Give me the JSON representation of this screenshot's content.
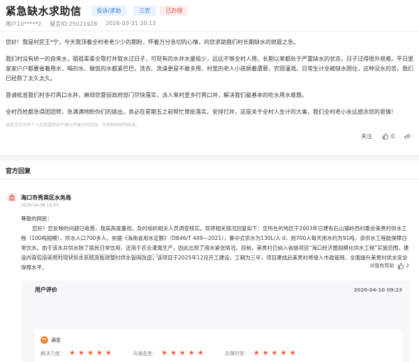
{
  "header": {
    "title": "紧急缺水求助信",
    "tags": [
      "投诉/求助",
      "三农",
      "已办理"
    ]
  },
  "meta": {
    "user": "用户10*****2",
    "message_id": "留言ID:25021928",
    "datetime": "2026-03-31 20:13"
  },
  "letter": {
    "paragraphs": [
      "您好！我是村民王*宁，今天我顶着全村老老少少的期盼，怀着万分急切的心情，向您求助我们村长期缺水的燃眉之急。",
      "我们村没有统一的自来水，祖祖辈辈全靠打井取水过日子，可现有的水井水量极少，远远不够全村人用，长期以来都处于严重缺水的状态，日子过得很外艰难。平日里家家户户都要省着用水，喝的水、做饭的水都紧巴巴，洗衣、洗澡更是不敢多用，村里的老人小孩顾着遭罪，农田灌溉、日常生计全被缺水困住，这种没水的苦，我们已经熬了太久太久。",
      "恳请批准我们村多打两口水井，麻烦您督促政府部门尽快落实，派人来村里多打两口井，解决我们最基本的吃水用水难题。",
      "全村百姓都急得团团转，急满满地盼你们的挑出，务必在星期五之前帮忙审批落实、安排打井，这是关于全村人生计的大事，我们全村老小永远感念您的恩情！"
    ],
    "note": "该留言中涉有个人信息或网站不便公开展示的内容，仅供相关机构阅读。"
  },
  "actions": {
    "follow": "关注",
    "like_count": "0",
    "comment_count": ""
  },
  "official_reply": {
    "section_title": "官方回复",
    "department": "海口市秀英区水务局",
    "date": "2026-04-09 15:55",
    "greeting": "尊敬的网民：",
    "body": "您好！您反映的问题已收悉，我局高度重视，及时组织相关人员调查核实。现将相关情况回复如下：您所在的地区于2003年已建有石山镇岭西村委会美贯村供水工程（100吨规模），供水人口700多人。依据《海南省用水定额》（DB46/T 449—2021），集中式供水为130L/人·d，则700人每天用水约为91吨，该供水工程能保障日常饮水。由于该水井供水除了居民日常饮用，还用于农业灌溉生产，因此出现了用水紧张情况。目前，美贯村已纳入省级项目“海口经济圈规模化供水工程”实施范围，建设内容包括美贯村现状供水系统及推进整村供水管网改造，该项目于2025年12月开工建设，工期为三年，项目建成后美贯村将接入市政管网，全面提升美贯村供水安全保障水平。",
    "note": "以上内容为相关办理单位对留言事项做出的回复意见，平台不以展示，供参考。",
    "helpful_label": "对我有帮助",
    "helpful_count": "2"
  },
  "evaluation": {
    "title": "用户评价",
    "date": "2026-04-10 09:23",
    "satisfaction": "满意",
    "criteria": [
      {
        "label": "解决力度：",
        "stars": 5
      },
      {
        "label": "沟通态度：",
        "stars": 5
      },
      {
        "label": "办理时效：",
        "stars": 5
      }
    ]
  },
  "colors": {
    "tag_blue_bg": "#eaf2ff",
    "tag_blue_fg": "#3a7bd5",
    "tag_red_bg": "#fdecec",
    "tag_red_fg": "#e04848",
    "star": "#f5583a"
  }
}
